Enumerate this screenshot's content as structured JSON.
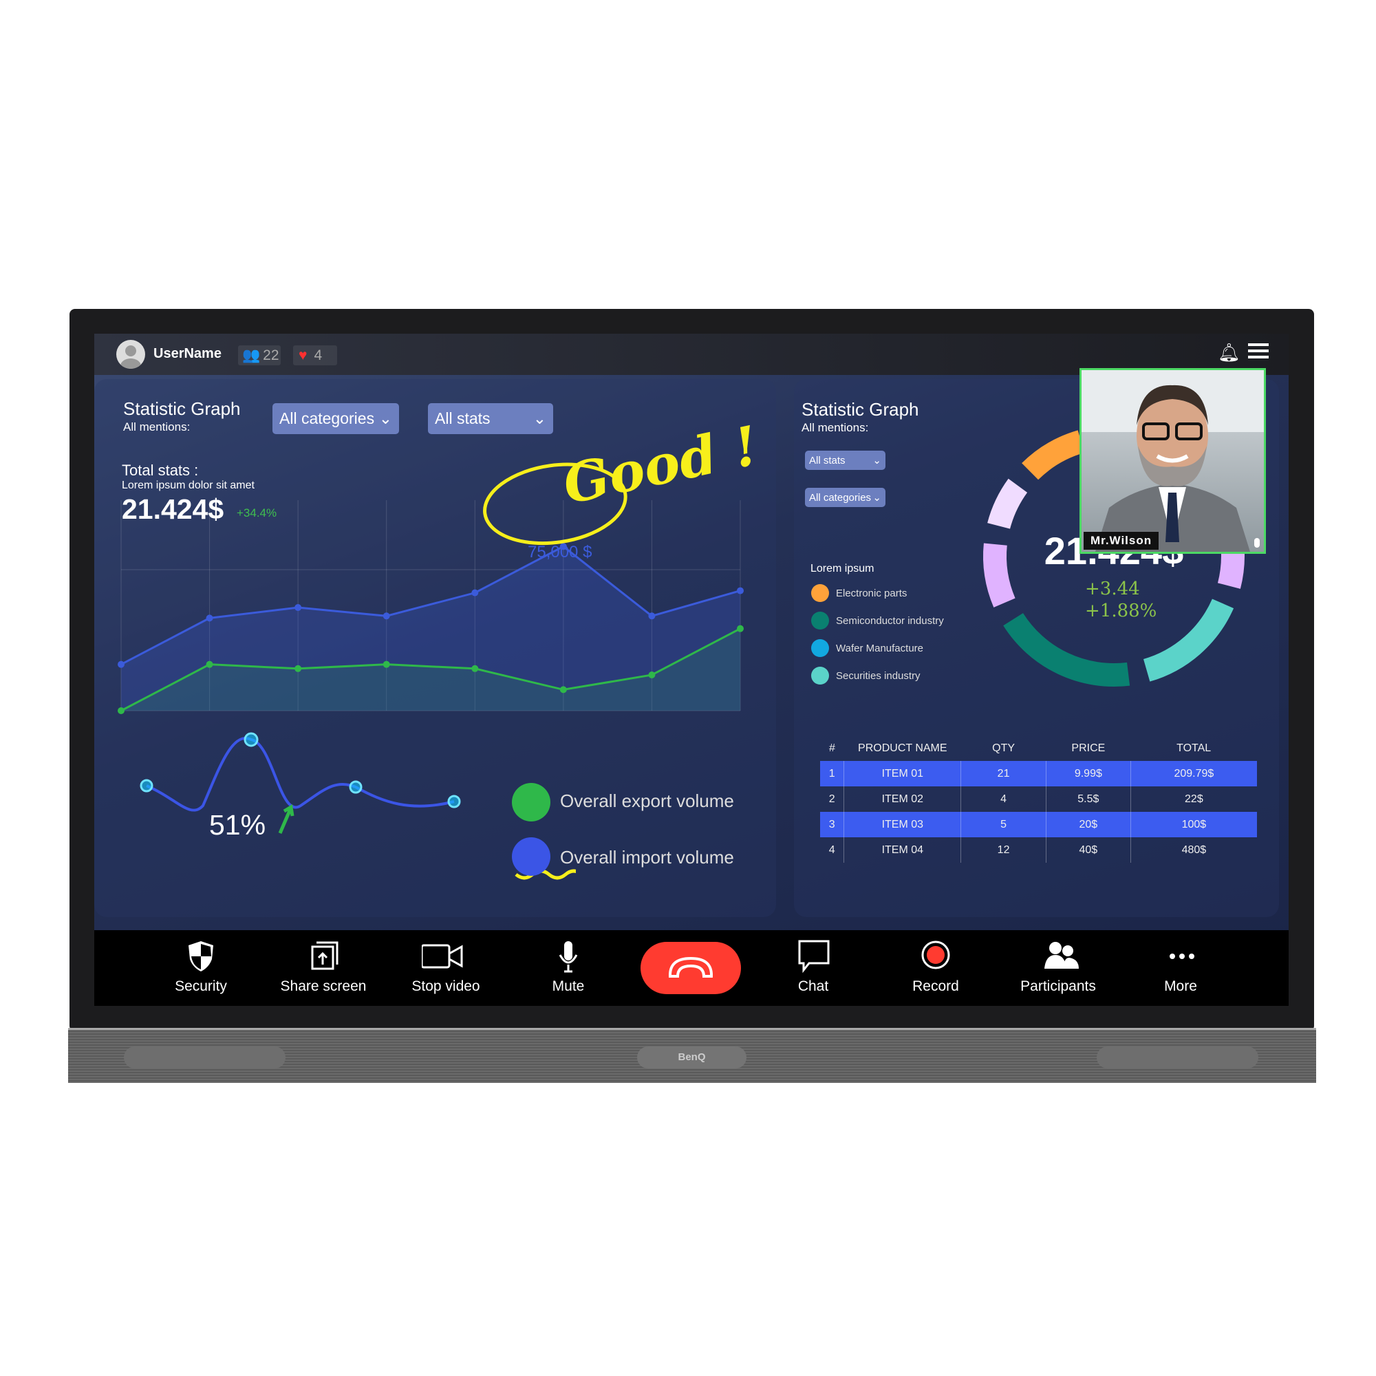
{
  "topbar": {
    "username": "UserName",
    "participants_count": "22",
    "likes_count": "4",
    "icons": [
      "avatar-icon",
      "people-icon",
      "heart-icon",
      "bell-icon",
      "menu-icon"
    ]
  },
  "left_panel": {
    "title": "Statistic Graph",
    "subtitle": "All mentions:",
    "dropdown_categories": "All categories",
    "dropdown_stats": "All stats",
    "total_label": "Total stats :",
    "total_desc": "Lorem ipsum dolor sit amet",
    "total_value": "21.424$",
    "total_change": "+34.4%",
    "annotation_good": "Good !",
    "wave_percent": "51%",
    "legend": [
      {
        "label": "Overall export volume",
        "color": "#2fb84a"
      },
      {
        "label": "Overall import volume",
        "color": "#3b55e6"
      }
    ]
  },
  "chart_data": [
    {
      "type": "area",
      "x": [
        1,
        2,
        3,
        4,
        5,
        6,
        7,
        8
      ],
      "series": [
        {
          "values": [
            22,
            44,
            49,
            45,
            56,
            78,
            45,
            57
          ],
          "color": "#3b5bdb"
        },
        {
          "values": [
            0,
            22,
            20,
            22,
            20,
            10,
            17,
            39
          ],
          "color": "#2fb84a"
        }
      ],
      "ylim": [
        0,
        100
      ],
      "grid": true,
      "annotations": [
        "75,000 $"
      ]
    },
    {
      "type": "pie",
      "segments": [
        {
          "value": 8,
          "color": "#ffa23a"
        },
        {
          "value": 6,
          "color": "#f0dcff"
        },
        {
          "value": 8,
          "color": "#e0b3ff"
        },
        {
          "value": 18,
          "color": "#0a8070"
        },
        {
          "value": 14,
          "color": "#5bd3c9"
        },
        {
          "value": 5,
          "color": "#e0b3ff"
        },
        {
          "value": 4,
          "color": "#c4284a"
        }
      ],
      "center_value": "21.424$",
      "center_change_1": "+3.44",
      "center_change_2": "+1.88%"
    }
  ],
  "right_panel": {
    "title": "Statistic Graph",
    "subtitle": "All mentions:",
    "dropdown_stats": "All stats",
    "dropdown_categories": "All categories",
    "legend_title": "Lorem ipsum",
    "legend": [
      {
        "label": "Electronic parts",
        "color": "#ffa23a"
      },
      {
        "label": "Semiconductor industry",
        "color": "#0a8070"
      },
      {
        "label": "Wafer Manufacture",
        "color": "#12a8e0"
      },
      {
        "label": "Securities industry",
        "color": "#5bd3c9"
      }
    ],
    "table": {
      "headers": [
        "#",
        "PRODUCT NAME",
        "QTY",
        "PRICE",
        "TOTAL"
      ],
      "rows": [
        [
          "1",
          "ITEM 01",
          "21",
          "9.99$",
          "209.79$"
        ],
        [
          "2",
          "ITEM 02",
          "4",
          "5.5$",
          "22$"
        ],
        [
          "3",
          "ITEM 03",
          "5",
          "20$",
          "100$"
        ],
        [
          "4",
          "ITEM 04",
          "12",
          "40$",
          "480$"
        ]
      ],
      "highlight_color": "#3c5cf0"
    }
  },
  "video": {
    "name": "Mr.Wilson",
    "border_color": "#4cd964"
  },
  "toolbar": {
    "items": [
      "Security",
      "Share screen",
      "Stop video",
      "Mute",
      "",
      "Chat",
      "Record",
      "Participants",
      "More"
    ],
    "end_call_color": "#ff3b30"
  },
  "bezel": {
    "brand": "BenQ"
  }
}
